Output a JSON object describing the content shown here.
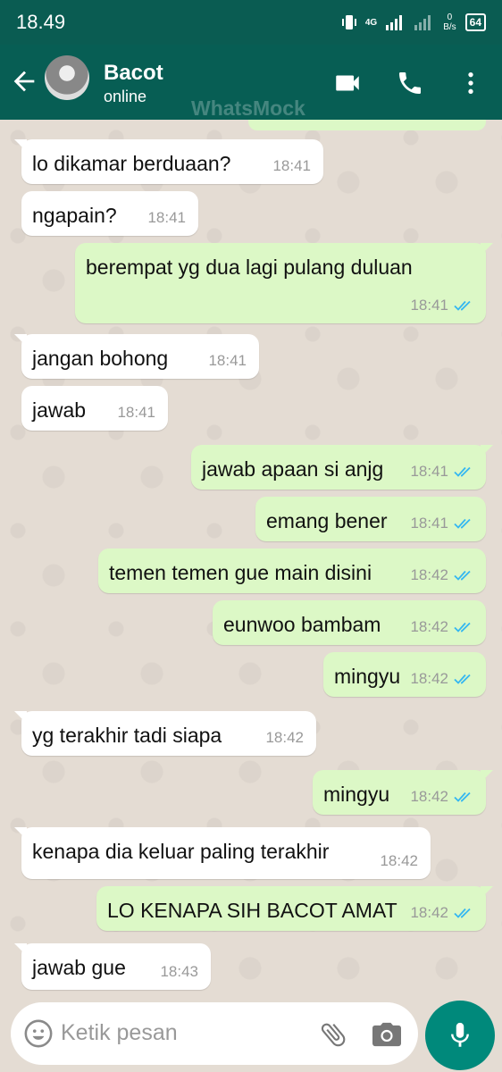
{
  "status_bar": {
    "time": "18.49",
    "network": "4G",
    "speed_value": "0",
    "speed_unit": "B/s",
    "battery": "64"
  },
  "header": {
    "contact_name": "Bacot",
    "contact_status": "online",
    "watermark": "WhatsMock"
  },
  "messages": [
    {
      "dir": "in",
      "text": "lo dikamar berduaan?",
      "time": "18:41"
    },
    {
      "dir": "in",
      "text": "ngapain?",
      "time": "18:41"
    },
    {
      "dir": "out",
      "text": "berempat yg dua lagi pulang duluan",
      "time": "18:41",
      "read": true
    },
    {
      "dir": "in",
      "text": "jangan bohong",
      "time": "18:41"
    },
    {
      "dir": "in",
      "text": "jawab",
      "time": "18:41"
    },
    {
      "dir": "out",
      "text": "jawab apaan si anjg",
      "time": "18:41",
      "read": true
    },
    {
      "dir": "out",
      "text": "emang bener",
      "time": "18:41",
      "read": true
    },
    {
      "dir": "out",
      "text": "temen temen gue main disini",
      "time": "18:42",
      "read": true
    },
    {
      "dir": "out",
      "text": "eunwoo bambam",
      "time": "18:42",
      "read": true
    },
    {
      "dir": "out",
      "text": "mingyu",
      "time": "18:42",
      "read": true
    },
    {
      "dir": "in",
      "text": "yg terakhir tadi siapa",
      "time": "18:42"
    },
    {
      "dir": "out",
      "text": "mingyu",
      "time": "18:42",
      "read": true
    },
    {
      "dir": "in",
      "text": "kenapa dia keluar paling terakhir",
      "time": "18:42"
    },
    {
      "dir": "out",
      "text": "LO KENAPA SIH BACOT AMAT",
      "time": "18:42",
      "read": true
    },
    {
      "dir": "in",
      "text": "jawab gue",
      "time": "18:43"
    }
  ],
  "input": {
    "placeholder": "Ketik pesan",
    "value": ""
  },
  "colors": {
    "header": "#075e54",
    "status_bar": "#0a5c52",
    "outgoing_bubble": "#dcf8c6",
    "incoming_bubble": "#ffffff",
    "read_ticks": "#34b7f1",
    "mic_button": "#00897b"
  },
  "icons": [
    "back-arrow-icon",
    "video-call-icon",
    "phone-icon",
    "more-vert-icon",
    "emoji-icon",
    "attach-icon",
    "camera-icon",
    "mic-icon",
    "double-check-icon"
  ]
}
